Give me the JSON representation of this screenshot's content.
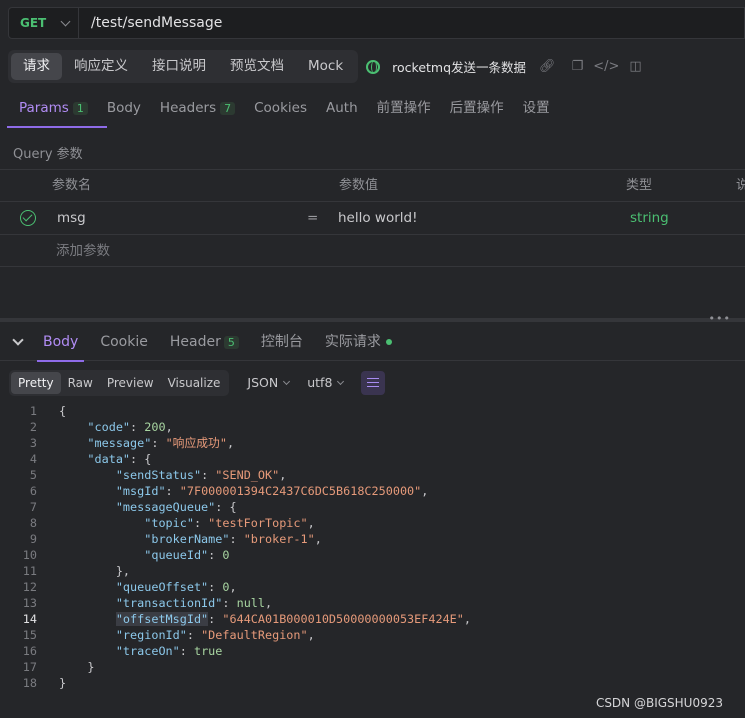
{
  "request": {
    "method": "GET",
    "url": "/test/sendMessage"
  },
  "top_tabs": [
    {
      "label": "请求",
      "active": true
    },
    {
      "label": "响应定义"
    },
    {
      "label": "接口说明"
    },
    {
      "label": "预览文档"
    },
    {
      "label": "Mock"
    }
  ],
  "api_name": "rocketmq发送一条数据",
  "param_tabs": [
    {
      "label": "Params",
      "count": "1",
      "active": true
    },
    {
      "label": "Body"
    },
    {
      "label": "Headers",
      "count": "7"
    },
    {
      "label": "Cookies"
    },
    {
      "label": "Auth"
    },
    {
      "label": "前置操作"
    },
    {
      "label": "后置操作"
    },
    {
      "label": "设置"
    }
  ],
  "query_section_title": "Query 参数",
  "params_table": {
    "headers": [
      "参数名",
      "参数值",
      "类型",
      "说"
    ],
    "rows": [
      {
        "name": "msg",
        "eq": "=",
        "value": "hello world!",
        "type": "string"
      }
    ],
    "add_label": "添加参数"
  },
  "response_tabs": [
    {
      "label": "Body",
      "active": true
    },
    {
      "label": "Cookie"
    },
    {
      "label": "Header",
      "count": "5"
    },
    {
      "label": "控制台"
    },
    {
      "label": "实际请求",
      "dot": true
    }
  ],
  "format_tabs": [
    {
      "label": "Pretty",
      "active": true
    },
    {
      "label": "Raw"
    },
    {
      "label": "Preview"
    },
    {
      "label": "Visualize"
    }
  ],
  "format_select": "JSON",
  "encoding_select": "utf8",
  "current_line": 14,
  "code_lines": [
    "{",
    "    \"code\": 200,",
    "    \"message\": \"响应成功\",",
    "    \"data\": {",
    "        \"sendStatus\": \"SEND_OK\",",
    "        \"msgId\": \"7F000001394C2437C6DC5B618C250000\",",
    "        \"messageQueue\": {",
    "            \"topic\": \"testForTopic\",",
    "            \"brokerName\": \"broker-1\",",
    "            \"queueId\": 0",
    "        },",
    "        \"queueOffset\": 0,",
    "        \"transactionId\": null,",
    "        \"offsetMsgId\": \"644CA01B000010D50000000053EF424E\",",
    "        \"regionId\": \"DefaultRegion\",",
    "        \"traceOn\": true",
    "    }",
    "}"
  ],
  "watermark": "CSDN @BIGSHU0923"
}
